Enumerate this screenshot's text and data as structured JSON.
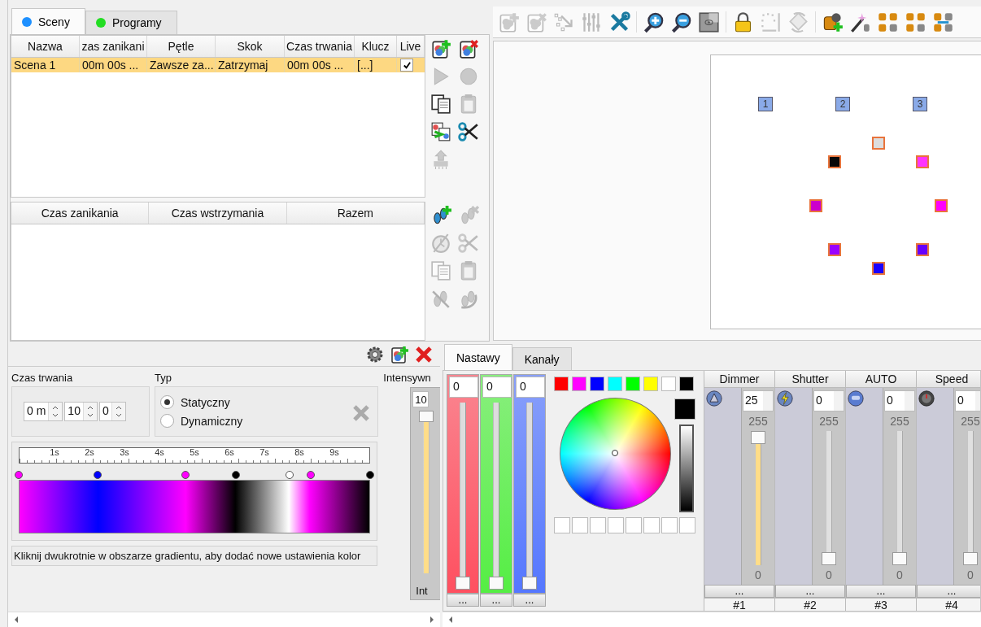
{
  "scene_tabs": [
    {
      "label": "Sceny",
      "color": "#1e90ff",
      "selected": true
    },
    {
      "label": "Programy",
      "color": "#22dd22",
      "selected": false
    }
  ],
  "scenes": {
    "columns": [
      "Nazwa",
      "zas zanikani",
      "Pętle",
      "Skok",
      "Czas trwania",
      "Klucz",
      "Live"
    ],
    "rows": [
      {
        "cells": [
          "Scena 1",
          "00m 00s ...",
          "Zawsze za...",
          "Zatrzymaj",
          "00m 00s ...",
          "[...]"
        ],
        "live": true,
        "selected": true
      }
    ]
  },
  "scene_tools": [
    {
      "kind": "add",
      "disabled": false
    },
    {
      "kind": "remove",
      "disabled": false
    },
    {
      "kind": "play",
      "disabled": true
    },
    {
      "kind": "record",
      "disabled": true
    },
    {
      "kind": "copy",
      "disabled": false
    },
    {
      "kind": "paste",
      "disabled": true
    },
    {
      "kind": "merge",
      "disabled": false
    },
    {
      "kind": "cut",
      "disabled": false
    },
    {
      "kind": "chip",
      "disabled": true
    }
  ],
  "steps": {
    "columns": [
      "Czas zanikania",
      "Czas wstrzymania",
      "Razem"
    ]
  },
  "step_tools": [
    {
      "kind": "step-add",
      "disabled": false
    },
    {
      "kind": "step-remove",
      "disabled": true
    },
    {
      "kind": "timer",
      "disabled": true
    },
    {
      "kind": "cut",
      "disabled": true
    },
    {
      "kind": "copy",
      "disabled": true
    },
    {
      "kind": "paste",
      "disabled": true
    },
    {
      "kind": "step-cross",
      "disabled": true
    },
    {
      "kind": "step-loop",
      "disabled": true
    }
  ],
  "toolbar": [
    {
      "kind": "add",
      "disabled": true
    },
    {
      "kind": "remove",
      "disabled": true
    },
    {
      "kind": "path",
      "disabled": true
    },
    {
      "kind": "faders",
      "disabled": true
    },
    {
      "kind": "tools",
      "disabled": false
    },
    {
      "kind": "sep"
    },
    {
      "kind": "zoom-in",
      "disabled": false
    },
    {
      "kind": "zoom-out",
      "disabled": false
    },
    {
      "kind": "view",
      "disabled": false
    },
    {
      "kind": "sep"
    },
    {
      "kind": "lock",
      "disabled": false
    },
    {
      "kind": "frame",
      "disabled": true
    },
    {
      "kind": "rotate",
      "disabled": true
    },
    {
      "kind": "sep"
    },
    {
      "kind": "head-add",
      "disabled": false
    },
    {
      "kind": "wand",
      "disabled": false
    },
    {
      "kind": "heads",
      "disabled": false
    },
    {
      "kind": "heads",
      "disabled": false
    },
    {
      "kind": "heads-link",
      "disabled": false
    }
  ],
  "monitor": {
    "heads": [
      {
        "label": "1"
      },
      {
        "label": "2"
      },
      {
        "label": "3"
      }
    ],
    "points": [
      {
        "color": "#dddddd"
      },
      {
        "color": "#ff33ff"
      },
      {
        "color": "#ff00ff"
      },
      {
        "color": "#6600ff"
      },
      {
        "color": "#1a00ff"
      },
      {
        "color": "#9900ff"
      },
      {
        "color": "#cc00cc"
      },
      {
        "color": "#080808"
      }
    ]
  },
  "editor_tools": [
    {
      "kind": "settings",
      "disabled": false
    },
    {
      "kind": "add",
      "disabled": false
    },
    {
      "kind": "delete",
      "disabled": false
    }
  ],
  "duration": {
    "label": "Czas trwania",
    "fields": [
      "0 m",
      "10",
      "0"
    ]
  },
  "type": {
    "label": "Typ",
    "options": [
      {
        "label": "Statyczny",
        "selected": true
      },
      {
        "label": "Dynamiczny",
        "selected": false
      }
    ]
  },
  "intensity": {
    "label": "Intensywn",
    "value": "10",
    "level": 1,
    "footer": "Int"
  },
  "gradient": {
    "ticks": [
      "1s",
      "2s",
      "3s",
      "4s",
      "5s",
      "6s",
      "7s",
      "8s",
      "9s"
    ],
    "stops": [
      {
        "color": "#ff00ff"
      },
      {
        "color": "#0000ff"
      },
      {
        "color": "#ff00ff"
      },
      {
        "color": "#000000"
      },
      {
        "color": "#ffffff"
      },
      {
        "color": "#ff00ff"
      },
      {
        "color": "#000000"
      }
    ]
  },
  "hint": "Kliknij dwukrotnie w obszarze gradientu, aby dodać nowe ustawienia kolor",
  "editor_tabs": [
    {
      "label": "Nastawy",
      "selected": true
    },
    {
      "label": "Kanały",
      "selected": false
    }
  ],
  "rgb": [
    {
      "value": "0",
      "color": "#ff5060",
      "level": 0,
      "button": "..."
    },
    {
      "value": "0",
      "color": "#55ee44",
      "level": 0,
      "button": "..."
    },
    {
      "value": "0",
      "color": "#5577ff",
      "level": 0,
      "button": "..."
    }
  ],
  "palette": {
    "swatches": [
      {
        "color": "#ff0000"
      },
      {
        "color": "#ff00ff"
      },
      {
        "color": "#0000ff"
      },
      {
        "color": "#00ffff"
      },
      {
        "color": "#00ff00"
      },
      {
        "color": "#ffff00"
      },
      {
        "color": "#ffffff"
      },
      {
        "color": "#000000"
      }
    ],
    "custom": [
      {
        "color": "#ffffff"
      },
      {
        "color": "#ffffff"
      },
      {
        "color": "#ffffff"
      },
      {
        "color": "#ffffff"
      },
      {
        "color": "#ffffff"
      },
      {
        "color": "#ffffff"
      },
      {
        "color": "#ffffff"
      },
      {
        "color": "#ffffff"
      }
    ]
  },
  "channels": [
    {
      "name": "Dimmer",
      "kind": "dimmer",
      "value": "25",
      "max": "255",
      "min": "0",
      "level": 1,
      "button": "...",
      "number": "#1"
    },
    {
      "name": "Shutter",
      "kind": "shutter",
      "value": "0",
      "max": "255",
      "min": "0",
      "level": 0,
      "button": "...",
      "number": "#2"
    },
    {
      "name": "AUTO",
      "kind": "auto",
      "value": "0",
      "max": "255",
      "min": "0",
      "level": 0,
      "button": "...",
      "number": "#3"
    },
    {
      "name": "Speed",
      "kind": "speed",
      "value": "0",
      "max": "255",
      "min": "0",
      "level": 0,
      "button": "...",
      "number": "#4"
    }
  ]
}
